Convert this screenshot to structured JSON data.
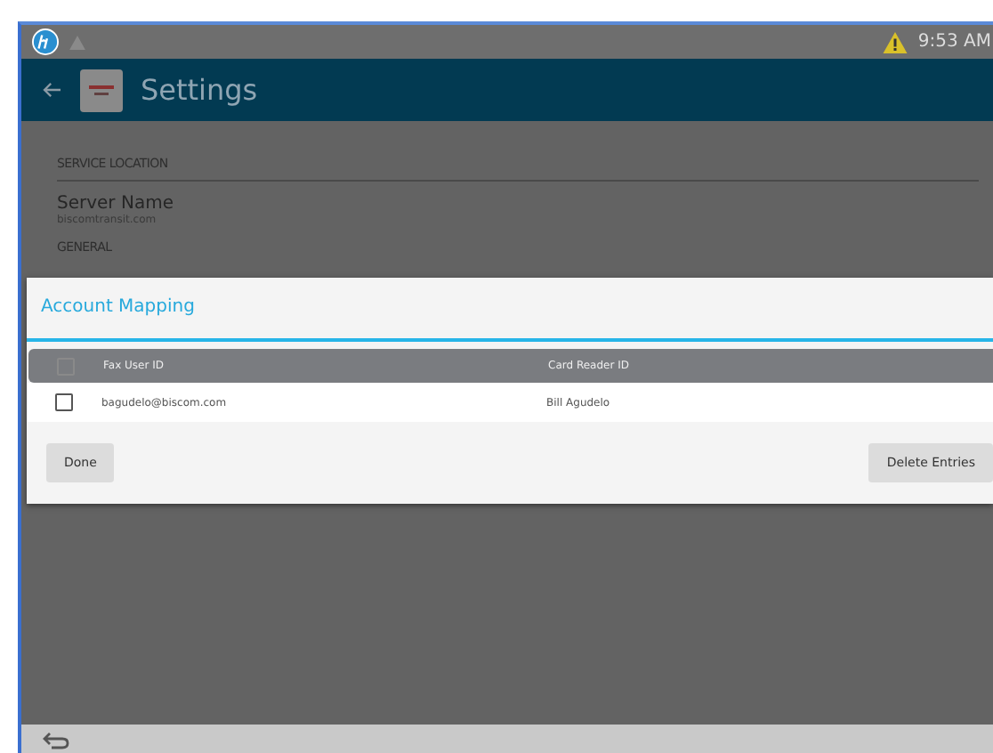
{
  "status_bar": {
    "time": "9:53 AM",
    "warning": true
  },
  "header": {
    "title": "Settings"
  },
  "settings": {
    "sections": [
      {
        "heading": "SERVICE LOCATION",
        "fields": [
          {
            "label": "Server Name",
            "value": "biscomtransit.com"
          }
        ]
      },
      {
        "heading": "GENERAL"
      }
    ]
  },
  "dialog": {
    "title": "Account Mapping",
    "table": {
      "select_all": {
        "checked": false
      },
      "columns": [
        "Fax User ID",
        "Card Reader ID"
      ],
      "rows": [
        {
          "checked": false,
          "cells": [
            "bagudelo@biscom.com",
            "Bill Agudelo"
          ]
        }
      ]
    },
    "buttons": [
      "Done",
      "Delete Entries"
    ]
  }
}
